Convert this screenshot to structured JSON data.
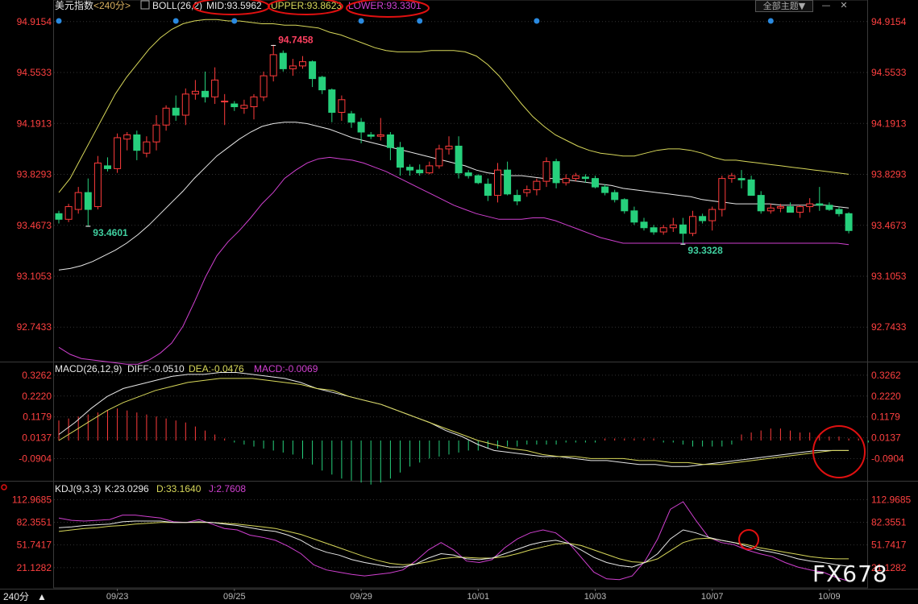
{
  "header": {
    "symbol": "美元指数",
    "period": "<240分>",
    "boll": "BOLL(26,2)",
    "mid": "MID:93.5962",
    "upper": "UPPER:93.8623",
    "lower": "LOWER:93.3301",
    "theme_button": "全部主题",
    "theme_arrow": "▼",
    "win_minus": "—",
    "win_close": "✕"
  },
  "macd_header": {
    "name": "MACD(26,12,9)",
    "diff": "DIFF:-0.0510",
    "dea": "DEA:-0.0476",
    "macd": "MACD:-0.0069"
  },
  "kdj_header": {
    "name": "KDJ(9,3,3)",
    "k": "K:23.0296",
    "d": "D:33.1640",
    "j": "J:2.7608"
  },
  "footer": {
    "period": "240分",
    "arrow": "▲"
  },
  "watermark": "FX678",
  "colors": {
    "up": "#ff3b3b",
    "down": "#26d07c",
    "mid": "#e8e8e8",
    "upper": "#d8d85a",
    "lower": "#d040d0",
    "axis": "#ff4040",
    "grid": "#333333"
  },
  "chart_data": [
    {
      "type": "candlestick",
      "title": "美元指数 <240分>",
      "y_ticks": [
        "94.9154",
        "94.5533",
        "94.1913",
        "93.8293",
        "93.4673",
        "93.1053",
        "92.7433"
      ],
      "ylim": [
        92.55,
        95.0
      ],
      "x_ticks": [
        {
          "label": "09/23",
          "index": 6
        },
        {
          "label": "09/25",
          "index": 18
        },
        {
          "label": "09/29",
          "index": 31
        },
        {
          "label": "10/01",
          "index": 43
        },
        {
          "label": "10/03",
          "index": 55
        },
        {
          "label": "10/07",
          "index": 67
        },
        {
          "label": "10/09",
          "index": 79
        }
      ],
      "annotations": [
        {
          "text": "94.7458",
          "index": 22,
          "value": 94.7458
        },
        {
          "text": "93.4601",
          "index": 3,
          "value": 93.4601
        },
        {
          "text": "93.3328",
          "index": 64,
          "value": 93.3328
        }
      ],
      "candles": [
        [
          93.55,
          93.57,
          93.48,
          93.51
        ],
        [
          93.51,
          93.62,
          93.49,
          93.6
        ],
        [
          93.58,
          93.74,
          93.55,
          93.7
        ],
        [
          93.7,
          93.8,
          93.46,
          93.58
        ],
        [
          93.6,
          93.96,
          93.58,
          93.91
        ],
        [
          93.89,
          93.95,
          93.85,
          93.87
        ],
        [
          93.87,
          94.12,
          93.84,
          94.09
        ],
        [
          94.08,
          94.13,
          94.0,
          94.11
        ],
        [
          94.11,
          94.14,
          93.93,
          94.0
        ],
        [
          93.98,
          94.1,
          93.95,
          94.06
        ],
        [
          94.06,
          94.25,
          94.0,
          94.18
        ],
        [
          94.18,
          94.32,
          94.14,
          94.3
        ],
        [
          94.3,
          94.39,
          94.21,
          94.25
        ],
        [
          94.25,
          94.44,
          94.18,
          94.4
        ],
        [
          94.4,
          94.5,
          94.36,
          94.42
        ],
        [
          94.42,
          94.56,
          94.34,
          94.38
        ],
        [
          94.38,
          94.59,
          94.33,
          94.5
        ],
        [
          94.35,
          94.4,
          94.18,
          94.35
        ],
        [
          94.33,
          94.35,
          94.28,
          94.31
        ],
        [
          94.3,
          94.36,
          94.26,
          94.32
        ],
        [
          94.31,
          94.4,
          94.22,
          94.38
        ],
        [
          94.38,
          94.56,
          94.35,
          94.53
        ],
        [
          94.53,
          94.75,
          94.49,
          94.68
        ],
        [
          94.69,
          94.71,
          94.56,
          94.58
        ],
        [
          94.58,
          94.65,
          94.53,
          94.6
        ],
        [
          94.6,
          94.67,
          94.58,
          94.63
        ],
        [
          94.63,
          94.64,
          94.45,
          94.51
        ],
        [
          94.52,
          94.53,
          94.4,
          94.43
        ],
        [
          94.43,
          94.44,
          94.2,
          94.27
        ],
        [
          94.27,
          94.39,
          94.21,
          94.36
        ],
        [
          94.26,
          94.28,
          94.16,
          94.2
        ],
        [
          94.2,
          94.23,
          94.05,
          94.13
        ],
        [
          94.11,
          94.13,
          94.08,
          94.1
        ],
        [
          94.1,
          94.23,
          94.07,
          94.11
        ],
        [
          94.11,
          94.13,
          93.93,
          94.02
        ],
        [
          94.02,
          94.06,
          93.82,
          93.88
        ],
        [
          93.88,
          93.9,
          93.82,
          93.86
        ],
        [
          93.86,
          93.9,
          93.82,
          93.84
        ],
        [
          93.84,
          93.92,
          93.83,
          93.89
        ],
        [
          93.89,
          94.04,
          93.87,
          94.01
        ],
        [
          94.01,
          94.1,
          93.97,
          94.03
        ],
        [
          94.03,
          94.1,
          93.8,
          93.84
        ],
        [
          93.84,
          93.86,
          93.8,
          93.82
        ],
        [
          93.82,
          93.83,
          93.76,
          93.77
        ],
        [
          93.76,
          93.8,
          93.64,
          93.68
        ],
        [
          93.68,
          93.91,
          93.63,
          93.86
        ],
        [
          93.86,
          93.92,
          93.68,
          93.69
        ],
        [
          93.68,
          93.72,
          93.61,
          93.64
        ],
        [
          93.7,
          93.75,
          93.67,
          93.72
        ],
        [
          93.72,
          93.8,
          93.68,
          93.78
        ],
        [
          93.78,
          93.95,
          93.74,
          93.92
        ],
        [
          93.92,
          93.94,
          93.73,
          93.77
        ],
        [
          93.77,
          93.83,
          93.75,
          93.8
        ],
        [
          93.8,
          93.84,
          93.78,
          93.82
        ],
        [
          93.81,
          93.83,
          93.77,
          93.8
        ],
        [
          93.8,
          93.82,
          93.73,
          93.74
        ],
        [
          93.74,
          93.76,
          93.68,
          93.7
        ],
        [
          93.7,
          93.72,
          93.63,
          93.65
        ],
        [
          93.65,
          93.66,
          93.55,
          93.57
        ],
        [
          93.57,
          93.6,
          93.47,
          93.49
        ],
        [
          93.49,
          93.52,
          93.43,
          93.45
        ],
        [
          93.45,
          93.47,
          93.4,
          93.42
        ],
        [
          93.42,
          93.47,
          93.4,
          93.45
        ],
        [
          93.45,
          93.52,
          93.42,
          93.47
        ],
        [
          93.47,
          93.52,
          93.33,
          93.41
        ],
        [
          93.41,
          93.57,
          93.39,
          93.53
        ],
        [
          93.53,
          93.55,
          93.48,
          93.5
        ],
        [
          93.5,
          93.6,
          93.43,
          93.58
        ],
        [
          93.58,
          93.82,
          93.53,
          93.8
        ],
        [
          93.8,
          93.84,
          93.77,
          93.82
        ],
        [
          93.8,
          93.86,
          93.73,
          93.79
        ],
        [
          93.79,
          93.82,
          93.68,
          93.68
        ],
        [
          93.68,
          93.71,
          93.55,
          93.57
        ],
        [
          93.57,
          93.62,
          93.55,
          93.59
        ],
        [
          93.59,
          93.62,
          93.56,
          93.6
        ],
        [
          93.6,
          93.63,
          93.56,
          93.56
        ],
        [
          93.56,
          93.61,
          93.52,
          93.6
        ],
        [
          93.6,
          93.66,
          93.56,
          93.62
        ],
        [
          93.62,
          93.74,
          93.57,
          93.61
        ],
        [
          93.61,
          93.63,
          93.57,
          93.58
        ],
        [
          93.58,
          93.6,
          93.53,
          93.55
        ],
        [
          93.55,
          93.56,
          93.41,
          93.43
        ]
      ],
      "boll_upper": [
        93.7,
        93.8,
        93.95,
        94.1,
        94.25,
        94.4,
        94.52,
        94.62,
        94.72,
        94.8,
        94.86,
        94.9,
        94.92,
        94.93,
        94.93,
        94.92,
        94.92,
        94.91,
        94.9,
        94.9,
        94.89,
        94.89,
        94.88,
        94.87,
        94.84,
        94.82,
        94.79,
        94.76,
        94.73,
        94.71,
        94.7,
        94.7,
        94.7,
        94.71,
        94.71,
        94.71,
        94.7,
        94.67,
        94.61,
        94.53,
        94.43,
        94.33,
        94.24,
        94.17,
        94.11,
        94.07,
        94.03,
        94.0,
        93.98,
        93.97,
        93.96,
        93.96,
        93.98,
        94.0,
        94.01,
        94.01,
        94.0,
        93.98,
        93.95,
        93.93,
        93.93,
        93.92,
        93.91,
        93.9,
        93.89,
        93.88,
        93.87,
        93.86,
        93.85,
        93.84,
        93.83
      ],
      "boll_mid": [
        93.15,
        93.16,
        93.18,
        93.21,
        93.25,
        93.29,
        93.34,
        93.4,
        93.47,
        93.55,
        93.63,
        93.71,
        93.8,
        93.88,
        93.96,
        94.02,
        94.08,
        94.13,
        94.17,
        94.19,
        94.2,
        94.2,
        94.19,
        94.17,
        94.15,
        94.12,
        94.09,
        94.07,
        94.05,
        94.03,
        94.01,
        93.99,
        93.97,
        93.95,
        93.93,
        93.91,
        93.89,
        93.86,
        93.84,
        93.83,
        93.82,
        93.82,
        93.81,
        93.8,
        93.8,
        93.79,
        93.78,
        93.77,
        93.76,
        93.75,
        93.73,
        93.72,
        93.71,
        93.7,
        93.69,
        93.68,
        93.67,
        93.65,
        93.64,
        93.63,
        93.62,
        93.62,
        93.62,
        93.62,
        93.61,
        93.61,
        93.61,
        93.61,
        93.61,
        93.6,
        93.59
      ],
      "boll_lower": [
        92.6,
        92.55,
        92.52,
        92.51,
        92.5,
        92.49,
        92.48,
        92.48,
        92.51,
        92.56,
        92.63,
        92.75,
        92.92,
        93.1,
        93.25,
        93.35,
        93.43,
        93.52,
        93.62,
        93.7,
        93.8,
        93.86,
        93.91,
        93.94,
        93.95,
        93.94,
        93.93,
        93.91,
        93.88,
        93.85,
        93.81,
        93.77,
        93.73,
        93.69,
        93.65,
        93.61,
        93.58,
        93.55,
        93.53,
        93.51,
        93.51,
        93.51,
        93.52,
        93.52,
        93.5,
        93.47,
        93.44,
        93.41,
        93.38,
        93.36,
        93.34,
        93.34,
        93.34,
        93.34,
        93.34,
        93.34,
        93.34,
        93.34,
        93.34,
        93.34,
        93.34,
        93.34,
        93.34,
        93.34,
        93.34,
        93.34,
        93.34,
        93.34,
        93.34,
        93.34,
        93.33
      ]
    },
    {
      "type": "macd",
      "y_ticks": [
        "0.3262",
        "0.2220",
        "0.1179",
        "0.0137",
        "-0.0904"
      ],
      "ylim": [
        -0.185,
        0.37
      ],
      "diff": [
        0.03,
        0.09,
        0.16,
        0.22,
        0.26,
        0.28,
        0.3,
        0.32,
        0.33,
        0.33,
        0.34,
        0.34,
        0.33,
        0.32,
        0.31,
        0.29,
        0.26,
        0.24,
        0.22,
        0.2,
        0.18,
        0.15,
        0.12,
        0.09,
        0.05,
        0.02,
        -0.02,
        -0.05,
        -0.06,
        -0.07,
        -0.08,
        -0.08,
        -0.09,
        -0.1,
        -0.1,
        -0.11,
        -0.12,
        -0.12,
        -0.13,
        -0.13,
        -0.12,
        -0.11,
        -0.1,
        -0.09,
        -0.08,
        -0.07,
        -0.06,
        -0.05,
        -0.05,
        -0.05
      ],
      "dea": [
        0.0,
        0.05,
        0.1,
        0.15,
        0.19,
        0.22,
        0.25,
        0.27,
        0.29,
        0.3,
        0.31,
        0.31,
        0.31,
        0.3,
        0.29,
        0.28,
        0.26,
        0.25,
        0.22,
        0.2,
        0.18,
        0.15,
        0.12,
        0.09,
        0.06,
        0.03,
        0.0,
        -0.02,
        -0.04,
        -0.05,
        -0.07,
        -0.08,
        -0.08,
        -0.09,
        -0.09,
        -0.09,
        -0.1,
        -0.1,
        -0.11,
        -0.11,
        -0.12,
        -0.12,
        -0.11,
        -0.1,
        -0.09,
        -0.08,
        -0.07,
        -0.06,
        -0.05,
        -0.05
      ],
      "hist": [
        0.1,
        0.11,
        0.12,
        0.13,
        0.14,
        0.15,
        0.16,
        0.15,
        0.14,
        0.13,
        0.12,
        0.11,
        0.1,
        0.09,
        0.07,
        0.05,
        0.03,
        0.01,
        -0.01,
        -0.02,
        -0.03,
        -0.04,
        -0.05,
        -0.06,
        -0.07,
        -0.09,
        -0.12,
        -0.15,
        -0.17,
        -0.19,
        -0.2,
        -0.21,
        -0.22,
        -0.21,
        -0.19,
        -0.16,
        -0.13,
        -0.11,
        -0.09,
        -0.08,
        -0.07,
        -0.06,
        -0.05,
        -0.05,
        -0.04,
        -0.04,
        -0.03,
        -0.03,
        -0.02,
        -0.02,
        -0.02,
        -0.02,
        -0.01,
        -0.01,
        -0.01,
        -0.01,
        0.01,
        0.01,
        0.01,
        0.01,
        0.01,
        0.01,
        -0.01,
        -0.01,
        -0.02,
        -0.03,
        -0.03,
        -0.03,
        -0.03,
        -0.02,
        0.03,
        0.04,
        0.05,
        0.06,
        0.06,
        0.05,
        0.04,
        0.04,
        0.03,
        0.02,
        0.02,
        0.01,
        0.01,
        -0.01
      ]
    },
    {
      "type": "kdj",
      "y_ticks": [
        "112.9685",
        "82.3551",
        "51.7417",
        "21.1282"
      ],
      "ylim": [
        -4,
        122
      ],
      "k": [
        75,
        76,
        78,
        79,
        80,
        83,
        84,
        84,
        84,
        82,
        82,
        83,
        82,
        80,
        78,
        75,
        72,
        70,
        65,
        58,
        48,
        42,
        38,
        32,
        28,
        25,
        22,
        22,
        26,
        34,
        40,
        38,
        33,
        32,
        34,
        40,
        46,
        52,
        56,
        58,
        54,
        45,
        35,
        28,
        24,
        22,
        28,
        40,
        60,
        72,
        68,
        62,
        58,
        55,
        50,
        45,
        42,
        38,
        33,
        30,
        28,
        25,
        23
      ],
      "d": [
        70,
        72,
        74,
        75,
        77,
        78,
        80,
        81,
        82,
        82,
        82,
        82,
        82,
        81,
        80,
        78,
        76,
        74,
        70,
        66,
        60,
        54,
        48,
        42,
        36,
        31,
        27,
        25,
        26,
        29,
        33,
        35,
        35,
        34,
        34,
        36,
        40,
        45,
        49,
        53,
        54,
        51,
        45,
        39,
        33,
        29,
        28,
        33,
        44,
        55,
        60,
        61,
        58,
        55,
        52,
        48,
        45,
        42,
        39,
        36,
        34,
        33,
        33
      ],
      "j": [
        88,
        85,
        84,
        85,
        86,
        92,
        92,
        90,
        88,
        83,
        82,
        86,
        80,
        74,
        72,
        65,
        62,
        58,
        50,
        40,
        25,
        18,
        15,
        12,
        10,
        12,
        14,
        18,
        30,
        45,
        55,
        45,
        30,
        28,
        32,
        48,
        60,
        68,
        72,
        68,
        55,
        35,
        15,
        6,
        5,
        10,
        30,
        60,
        100,
        110,
        85,
        62,
        55,
        52,
        45,
        40,
        36,
        28,
        22,
        18,
        15,
        8,
        3
      ]
    }
  ]
}
